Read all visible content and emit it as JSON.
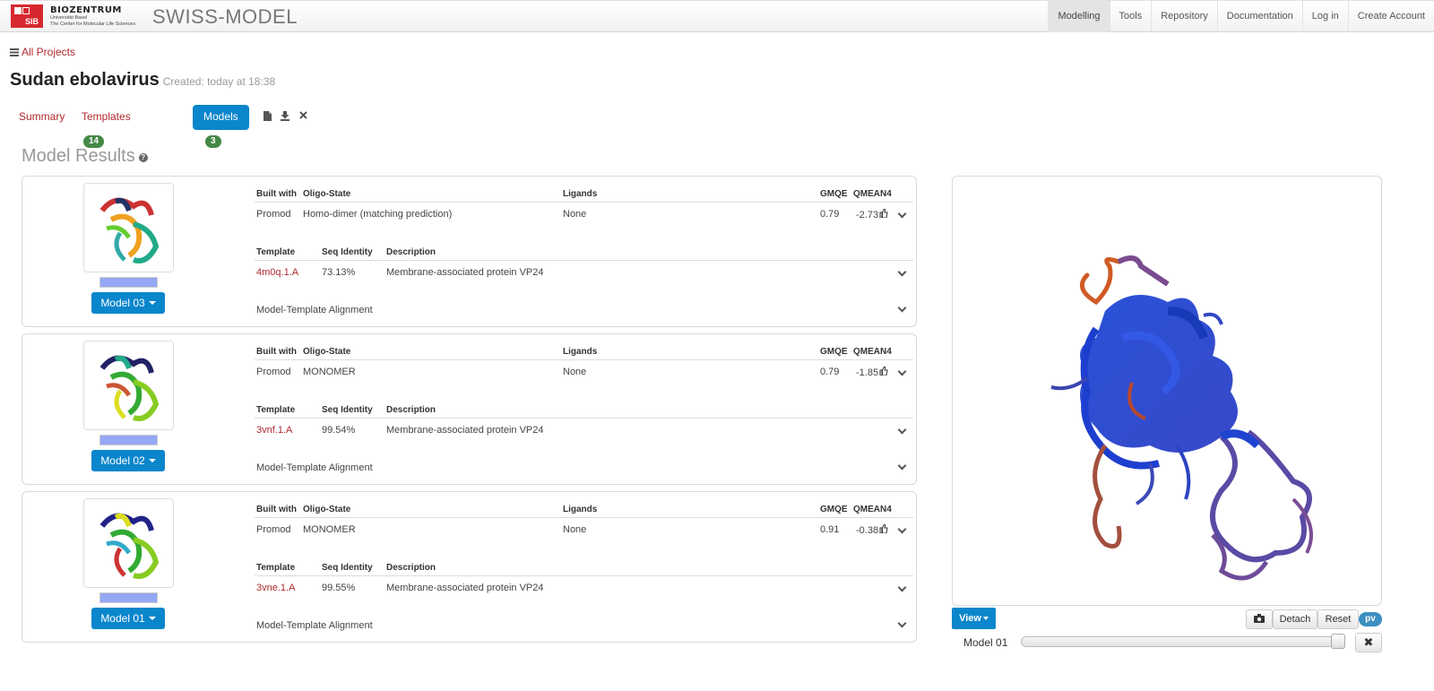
{
  "navbar": {
    "logo_sib": "SIB",
    "logo_bz_title": "BIOZENTRUM",
    "logo_bz_sub1": "Universität Basel",
    "logo_bz_sub2": "The Center for Molecular Life Sciences",
    "brand": "SWISS-MODEL",
    "items": [
      "Modelling",
      "Tools",
      "Repository",
      "Documentation",
      "Log in",
      "Create Account"
    ],
    "active": "Modelling"
  },
  "breadcrumb": {
    "all_projects": "All Projects"
  },
  "project": {
    "title": "Sudan ebolavirus",
    "created": "Created: today at 18:38"
  },
  "tabs": {
    "summary": "Summary",
    "templates": "Templates",
    "templates_count": "14",
    "models": "Models",
    "models_count": "3"
  },
  "section": {
    "title": "Model Results",
    "help": "?"
  },
  "table_headers": {
    "built_with": "Built with",
    "oligo_state": "Oligo-State",
    "ligands": "Ligands",
    "gmqe": "GMQE",
    "qmean4": "QMEAN4",
    "template": "Template",
    "seq_identity": "Seq Identity",
    "description": "Description",
    "alignment": "Model-Template Alignment"
  },
  "models": [
    {
      "button": "Model 03",
      "built_with": "Promod",
      "oligo_state": "Homo-dimer (matching prediction)",
      "ligands": "None",
      "gmqe": "0.79",
      "qmean4": "-2.73",
      "template": "4m0q.1.A",
      "seq_identity": "73.13%",
      "description": "Membrane-associated protein VP24"
    },
    {
      "button": "Model 02",
      "built_with": "Promod",
      "oligo_state": "MONOMER",
      "ligands": "None",
      "gmqe": "0.79",
      "qmean4": "-1.85",
      "template": "3vnf.1.A",
      "seq_identity": "99.54%",
      "description": "Membrane-associated protein VP24"
    },
    {
      "button": "Model 01",
      "built_with": "Promod",
      "oligo_state": "MONOMER",
      "ligands": "None",
      "gmqe": "0.91",
      "qmean4": "-0.38",
      "template": "3vne.1.A",
      "seq_identity": "99.55%",
      "description": "Membrane-associated protein VP24"
    }
  ],
  "viewer": {
    "view_button": "View",
    "detach": "Detach",
    "reset": "Reset",
    "pv": "pv",
    "model_label": "Model 01",
    "close": "✖"
  },
  "icons": {
    "list": "list-icon",
    "file": "file-icon",
    "download": "download-icon",
    "close": "close-icon",
    "camera": "camera-icon",
    "thumbs_up": "thumbs-up-icon",
    "chevron": "chevron-down-icon"
  },
  "colors": {
    "primary_button": "#0a86cc",
    "link": "#b0282d",
    "badge_green": "#468847",
    "coverage_bar": "#95a8f5"
  }
}
